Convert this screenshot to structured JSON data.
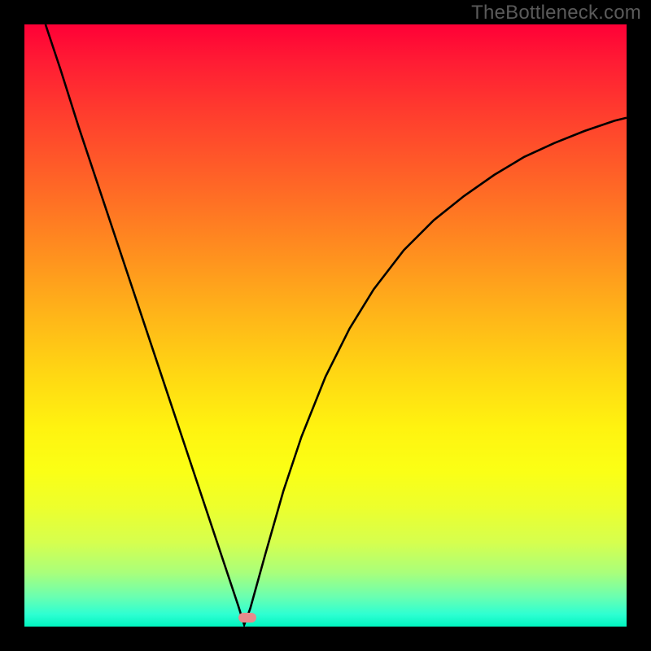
{
  "watermark": "TheBottleneck.com",
  "colors": {
    "frame_bg": "#000000",
    "gradient_top": "#ff0036",
    "gradient_bottom": "#00f5c0",
    "curve_stroke": "#000000",
    "marker_fill": "#e78b8c",
    "watermark_text": "#5a5a5a"
  },
  "chart_data": {
    "type": "line",
    "title": "",
    "xlabel": "",
    "ylabel": "",
    "x_range": [
      0,
      100
    ],
    "y_range": [
      0,
      100
    ],
    "grid": false,
    "legend": false,
    "notch_x": 36.5,
    "marker": {
      "x": 37,
      "y": 1.5
    },
    "curve_points": [
      {
        "x": 3.5,
        "y": 100.0
      },
      {
        "x": 6.0,
        "y": 92.5
      },
      {
        "x": 9.0,
        "y": 83.0
      },
      {
        "x": 12.0,
        "y": 74.0
      },
      {
        "x": 15.0,
        "y": 65.0
      },
      {
        "x": 18.0,
        "y": 56.0
      },
      {
        "x": 21.0,
        "y": 47.0
      },
      {
        "x": 24.0,
        "y": 38.0
      },
      {
        "x": 27.0,
        "y": 29.0
      },
      {
        "x": 30.0,
        "y": 20.0
      },
      {
        "x": 33.0,
        "y": 11.0
      },
      {
        "x": 35.5,
        "y": 3.5
      },
      {
        "x": 36.5,
        "y": 0.3
      },
      {
        "x": 37.5,
        "y": 3.0
      },
      {
        "x": 40.0,
        "y": 12.0
      },
      {
        "x": 43.0,
        "y": 22.5
      },
      {
        "x": 46.0,
        "y": 31.5
      },
      {
        "x": 50.0,
        "y": 41.5
      },
      {
        "x": 54.0,
        "y": 49.5
      },
      {
        "x": 58.0,
        "y": 56.0
      },
      {
        "x": 63.0,
        "y": 62.5
      },
      {
        "x": 68.0,
        "y": 67.5
      },
      {
        "x": 73.0,
        "y": 71.5
      },
      {
        "x": 78.0,
        "y": 75.0
      },
      {
        "x": 83.0,
        "y": 78.0
      },
      {
        "x": 88.0,
        "y": 80.3
      },
      {
        "x": 93.0,
        "y": 82.3
      },
      {
        "x": 98.0,
        "y": 84.0
      },
      {
        "x": 100.0,
        "y": 84.5
      }
    ]
  }
}
